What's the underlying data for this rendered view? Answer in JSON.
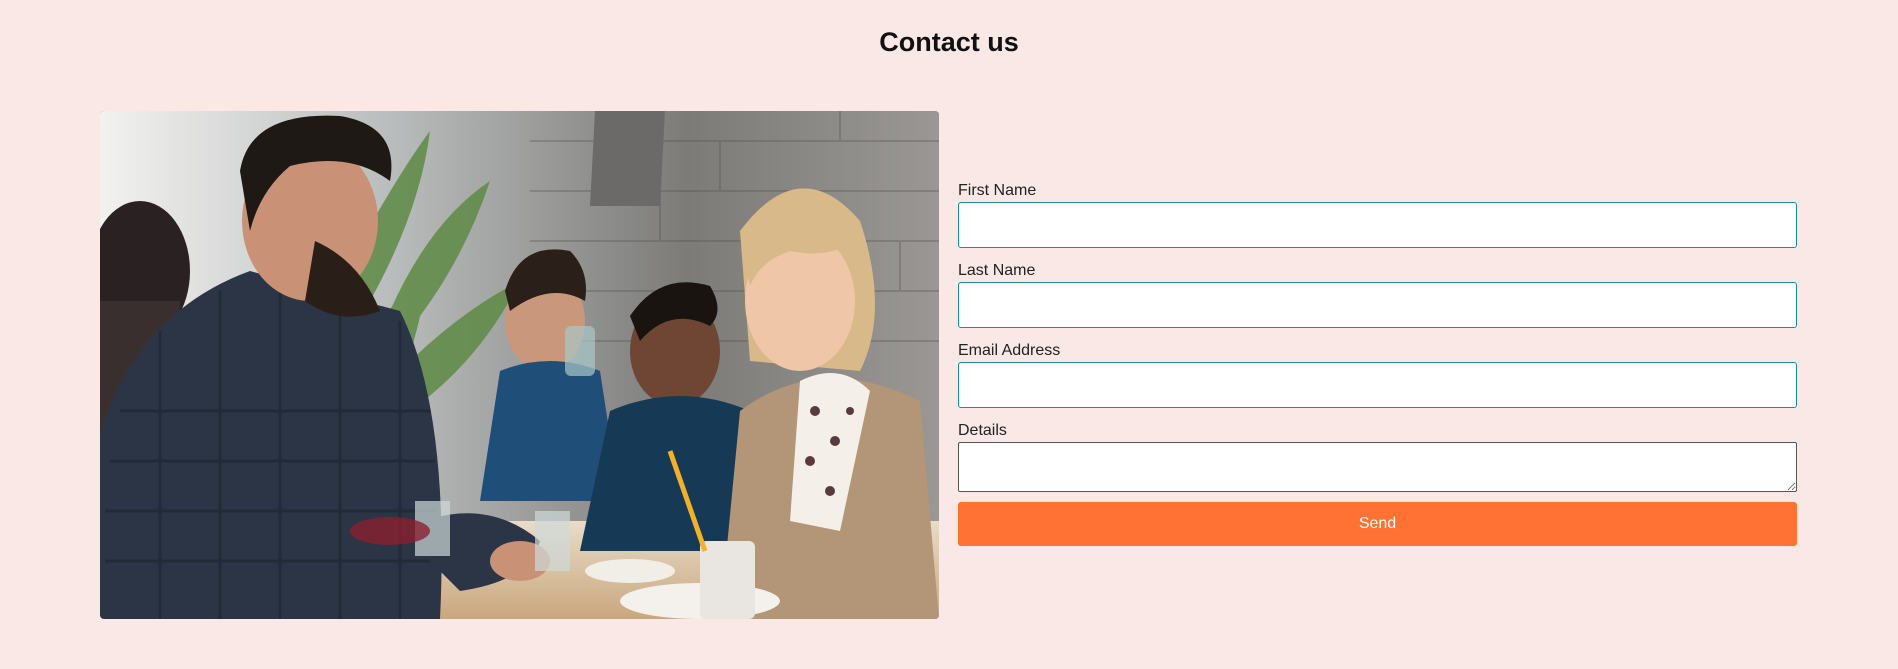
{
  "page": {
    "title": "Contact us"
  },
  "photo": {
    "description_icon": "restaurant-group-photo"
  },
  "form": {
    "fields": [
      {
        "label": "First Name",
        "value": "",
        "placeholder": ""
      },
      {
        "label": "Last Name",
        "value": "",
        "placeholder": ""
      },
      {
        "label": "Email Address",
        "value": "",
        "placeholder": ""
      }
    ],
    "details": {
      "label": "Details",
      "value": "",
      "placeholder": ""
    },
    "send_label": "Send"
  },
  "colors": {
    "background": "#f9e8e6",
    "input_border": "#1b8a9c",
    "button": "#ff7233",
    "button_text": "#ffffff"
  }
}
